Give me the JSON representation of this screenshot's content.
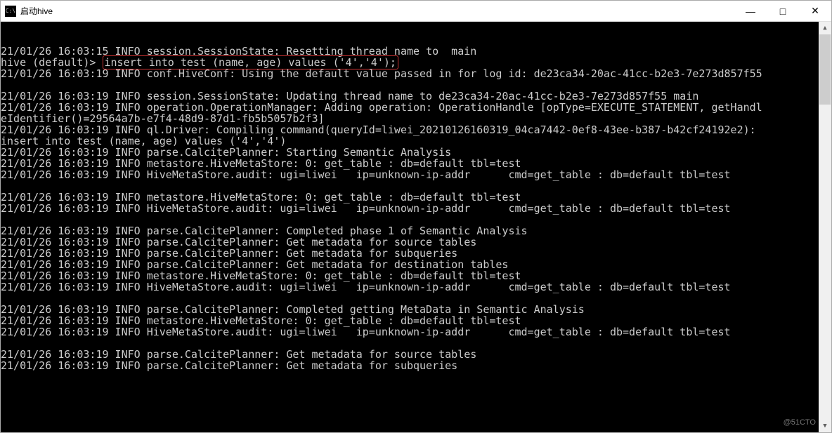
{
  "window": {
    "icon_label": "C:\\",
    "title": "启动hive",
    "minimize": "—",
    "maximize": "□",
    "close": "✕"
  },
  "highlight_hive_prompt": "hive (default)>",
  "highlight_sql": "insert into test (name, age) values ('4','4');",
  "terminal_lines": [
    "",
    "21/01/26 16:03:15 INFO session.SessionState: Resetting thread name to  main",
    "__HIGHLIGHT__",
    "21/01/26 16:03:19 INFO conf.HiveConf: Using the default value passed in for log id: de23ca34-20ac-41cc-b2e3-7e273d857f55",
    "",
    "21/01/26 16:03:19 INFO session.SessionState: Updating thread name to de23ca34-20ac-41cc-b2e3-7e273d857f55 main",
    "21/01/26 16:03:19 INFO operation.OperationManager: Adding operation: OperationHandle [opType=EXECUTE_STATEMENT, getHandl",
    "eIdentifier()=29564a7b-e7f4-48d9-87d1-fb5b5057b2f3]",
    "21/01/26 16:03:19 INFO ql.Driver: Compiling command(queryId=liwei_20210126160319_04ca7442-0ef8-43ee-b387-b42cf24192e2):",
    "insert into test (name, age) values ('4','4')",
    "21/01/26 16:03:19 INFO parse.CalcitePlanner: Starting Semantic Analysis",
    "21/01/26 16:03:19 INFO metastore.HiveMetaStore: 0: get_table : db=default tbl=test",
    "21/01/26 16:03:19 INFO HiveMetaStore.audit: ugi=liwei   ip=unknown-ip-addr      cmd=get_table : db=default tbl=test",
    "",
    "21/01/26 16:03:19 INFO metastore.HiveMetaStore: 0: get_table : db=default tbl=test",
    "21/01/26 16:03:19 INFO HiveMetaStore.audit: ugi=liwei   ip=unknown-ip-addr      cmd=get_table : db=default tbl=test",
    "",
    "21/01/26 16:03:19 INFO parse.CalcitePlanner: Completed phase 1 of Semantic Analysis",
    "21/01/26 16:03:19 INFO parse.CalcitePlanner: Get metadata for source tables",
    "21/01/26 16:03:19 INFO parse.CalcitePlanner: Get metadata for subqueries",
    "21/01/26 16:03:19 INFO parse.CalcitePlanner: Get metadata for destination tables",
    "21/01/26 16:03:19 INFO metastore.HiveMetaStore: 0: get_table : db=default tbl=test",
    "21/01/26 16:03:19 INFO HiveMetaStore.audit: ugi=liwei   ip=unknown-ip-addr      cmd=get_table : db=default tbl=test",
    "",
    "21/01/26 16:03:19 INFO parse.CalcitePlanner: Completed getting MetaData in Semantic Analysis",
    "21/01/26 16:03:19 INFO metastore.HiveMetaStore: 0: get_table : db=default tbl=test",
    "21/01/26 16:03:19 INFO HiveMetaStore.audit: ugi=liwei   ip=unknown-ip-addr      cmd=get_table : db=default tbl=test",
    "",
    "21/01/26 16:03:19 INFO parse.CalcitePlanner: Get metadata for source tables",
    "21/01/26 16:03:19 INFO parse.CalcitePlanner: Get metadata for subqueries"
  ],
  "watermark": "@51CTO"
}
